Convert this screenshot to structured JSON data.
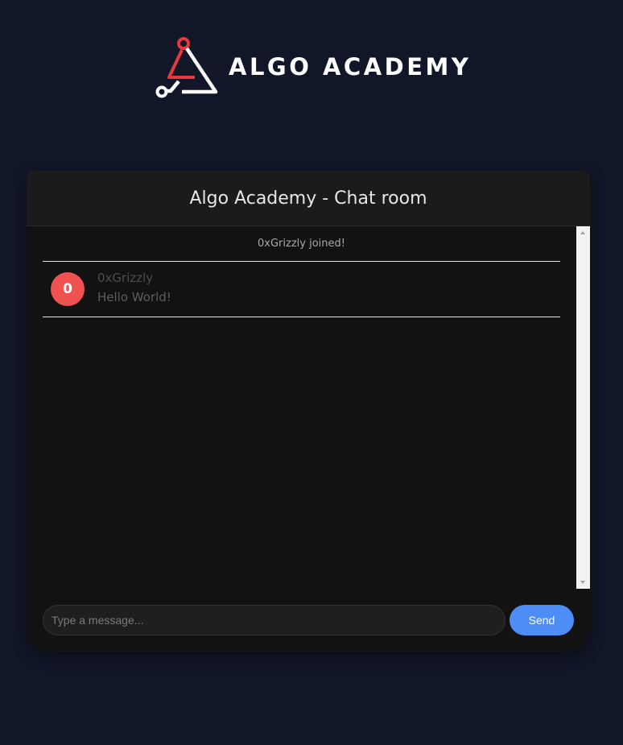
{
  "brand": {
    "name": "ALGO ACADEMY",
    "accent_color": "#e8383d",
    "logo_icon": "algo-academy-logo-icon"
  },
  "chat": {
    "title": "Algo Academy - Chat room",
    "system_message": "0xGrizzly joined!",
    "messages": [
      {
        "avatar_initial": "0",
        "avatar_color": "#f05252",
        "author": "0xGrizzly",
        "text": "Hello World!"
      }
    ]
  },
  "composer": {
    "placeholder": "Type a message...",
    "value": "",
    "send_label": "Send",
    "send_color": "#4f8df6"
  }
}
